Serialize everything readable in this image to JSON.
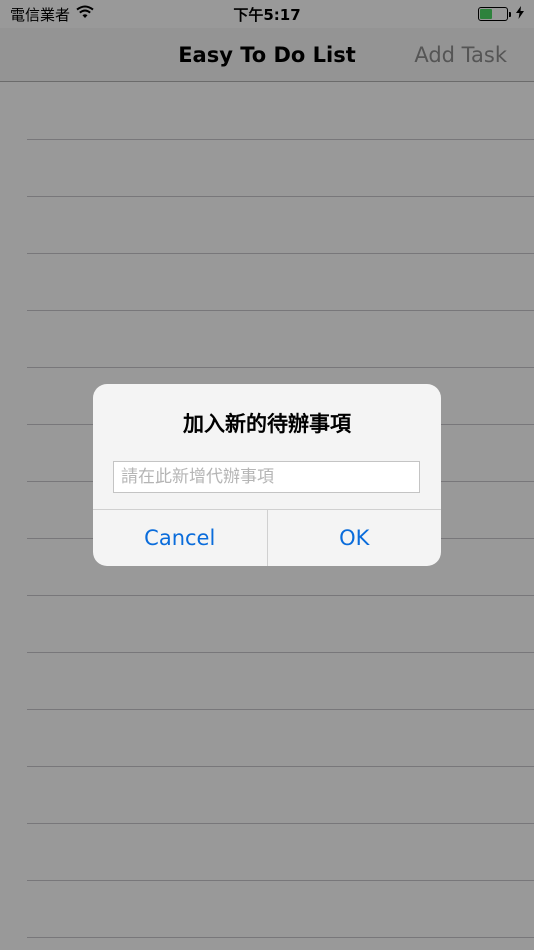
{
  "status_bar": {
    "carrier": "電信業者",
    "time": "下午5:17",
    "wifi_icon": "wifi-icon",
    "battery_icon": "battery-icon",
    "charging_icon": "charging-bolt-icon"
  },
  "nav": {
    "title": "Easy To Do List",
    "action": "Add Task"
  },
  "list": {
    "rows": [
      "",
      "",
      "",
      "",
      "",
      "",
      "",
      "",
      "",
      "",
      "",
      "",
      "",
      "",
      "",
      ""
    ]
  },
  "alert": {
    "title": "加入新的待辦事項",
    "input_placeholder": "請在此新增代辦事項",
    "input_value": "",
    "cancel_label": "Cancel",
    "ok_label": "OK"
  },
  "colors": {
    "accent": "#0a6cdb",
    "battery_fill": "#4cd964",
    "overlay": "rgba(0,0,0,0.4)"
  }
}
